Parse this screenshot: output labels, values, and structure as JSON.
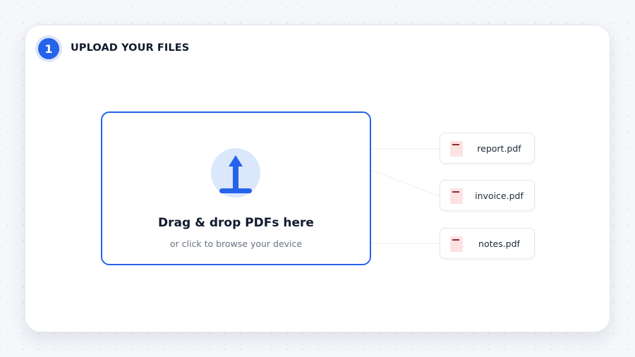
{
  "step": {
    "number": "1",
    "title": "UPLOAD YOUR FILES"
  },
  "dropzone": {
    "icon": "upload-arrow-icon",
    "title": "Drag & drop PDFs here",
    "subtitle": "or click to browse your device"
  },
  "files": [
    {
      "name": "report.pdf",
      "icon": "pdf-file-icon"
    },
    {
      "name": "invoice.pdf",
      "icon": "pdf-file-icon"
    },
    {
      "name": "notes.pdf",
      "icon": "pdf-file-icon"
    }
  ],
  "colors": {
    "accent": "#2563eb",
    "accent_soft": "#dbe7fb",
    "pdf_icon": "#fde2e2"
  }
}
